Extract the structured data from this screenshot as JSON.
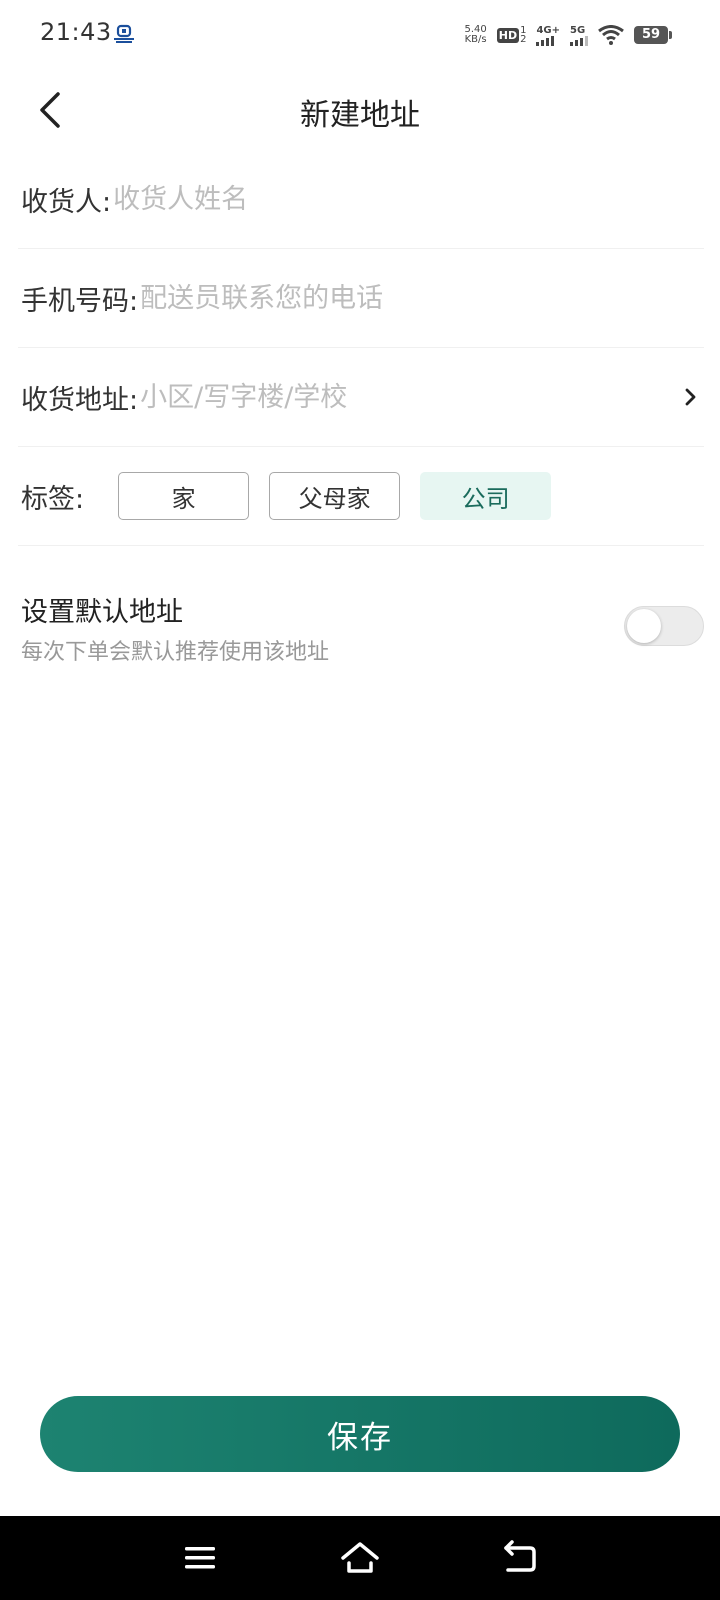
{
  "status_bar": {
    "time": "21:43",
    "net_speed_value": "5.40",
    "net_speed_unit": "KB/s",
    "hd_label": "HD",
    "hd_sub_top": "1",
    "hd_sub_bottom": "2",
    "signal1_label": "4G+",
    "signal2_label": "5G",
    "battery": "59",
    "icons": [
      "notification-icon",
      "wifi-icon",
      "battery-icon"
    ]
  },
  "header": {
    "title": "新建地址",
    "back_icon": "chevron-left-icon"
  },
  "form": {
    "receiver": {
      "label": "收货人:",
      "placeholder": "收货人姓名",
      "value": ""
    },
    "phone": {
      "label": "手机号码:",
      "placeholder": "配送员联系您的电话",
      "value": ""
    },
    "address": {
      "label": "收货地址:",
      "placeholder": "小区/写字楼/学校",
      "value": "",
      "chevron_icon": "chevron-right-icon"
    },
    "tags": {
      "label": "标签:",
      "options": [
        {
          "label": "家",
          "selected": false
        },
        {
          "label": "父母家",
          "selected": false
        },
        {
          "label": "公司",
          "selected": true
        }
      ]
    },
    "default_address": {
      "title": "设置默认地址",
      "subtitle": "每次下单会默认推荐使用该地址",
      "enabled": false
    }
  },
  "save_button": {
    "label": "保存"
  },
  "system_nav": {
    "icons": [
      "menu-icon",
      "home-icon",
      "back-icon"
    ]
  },
  "colors": {
    "primary": "#0e6a5c",
    "primary_light": "#1d8371",
    "tag_selected_bg": "#e7f6f2",
    "tag_selected_text": "#1a6b5c",
    "placeholder": "#bdbdbd",
    "subtext": "#999999"
  }
}
